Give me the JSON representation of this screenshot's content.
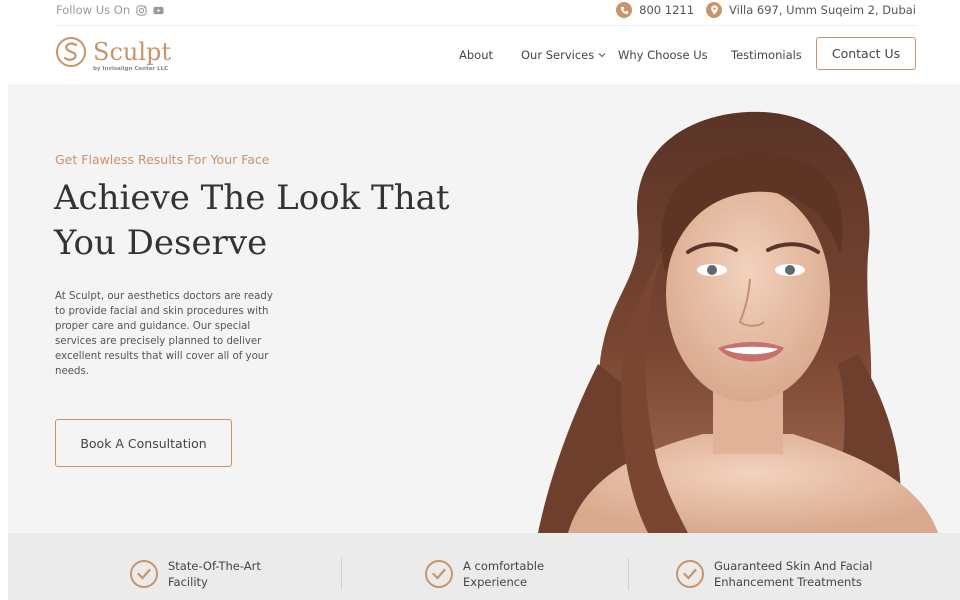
{
  "topbar": {
    "follow_label": "Follow Us On",
    "social_icons": [
      "instagram-icon",
      "youtube-icon"
    ],
    "phone": "800 1211",
    "address": "Villa 697, Umm Suqeim 2, Dubai"
  },
  "brand": {
    "name": "Sculpt",
    "subtitle": "by Invisalign Center LLC",
    "accent_color": "#c8946a"
  },
  "nav": {
    "items": [
      "About",
      "Our Services",
      "Why Choose Us",
      "Testimonials"
    ],
    "contact_label": "Contact Us"
  },
  "hero": {
    "tagline": "Get Flawless Results For Your Face",
    "headline_line1": "Achieve The Look That",
    "headline_line2": "You Deserve",
    "description": "At Sculpt, our aesthetics doctors are ready to provide facial and skin procedures with proper care and guidance. Our special services are precisely planned to deliver excellent results that will cover all of your needs.",
    "cta_label": "Book A Consultation"
  },
  "features": [
    {
      "text": "State-Of-The-Art\nFacility"
    },
    {
      "text": "A comfortable\nExperience"
    },
    {
      "text": "Guaranteed Skin And Facial\nEnhancement Treatments"
    }
  ]
}
